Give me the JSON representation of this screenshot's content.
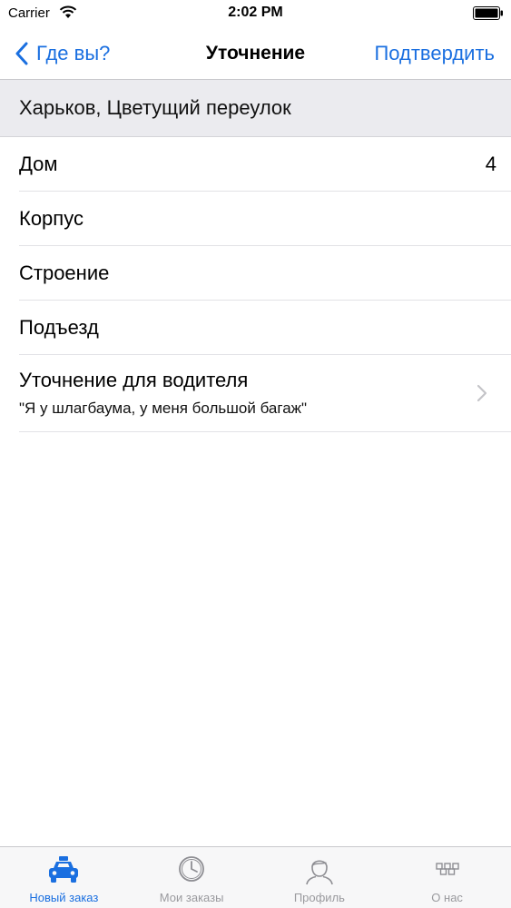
{
  "status_bar": {
    "carrier": "Carrier",
    "time": "2:02 PM"
  },
  "nav": {
    "back_label": "Где вы?",
    "title": "Уточнение",
    "confirm_label": "Подтвердить"
  },
  "address": "Харьков, Цветущий переулок",
  "rows": [
    {
      "label": "Дом",
      "value": "4"
    },
    {
      "label": "Корпус",
      "value": ""
    },
    {
      "label": "Строение",
      "value": ""
    },
    {
      "label": "Подъезд",
      "value": ""
    }
  ],
  "driver_note": {
    "label": "Уточнение для водителя",
    "value": "\"Я у шлагбаума, у меня большой багаж\""
  },
  "tabs": [
    {
      "label": "Новый заказ",
      "icon": "taxi-icon",
      "active": true
    },
    {
      "label": "Мои заказы",
      "icon": "clock-icon",
      "active": false
    },
    {
      "label": "Профиль",
      "icon": "user-icon",
      "active": false
    },
    {
      "label": "О нас",
      "icon": "checker-icon",
      "active": false
    }
  ],
  "colors": {
    "accent": "#1a6fe0",
    "inactive": "#9a9a9e",
    "header_bg": "#ebebef"
  }
}
